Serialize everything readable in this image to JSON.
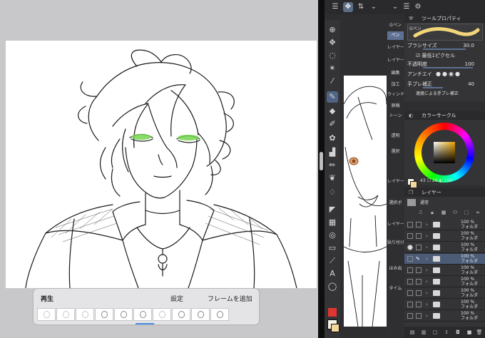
{
  "animation_bar": {
    "play": "再生",
    "settings": "設定",
    "add_frame": "フレームを追加",
    "frame_count": 10,
    "selected_frame": 6
  },
  "clip": {
    "top_icons_left": [
      "menu-icon",
      "layer-move-icon",
      "undo-icon",
      "chevron-icon"
    ],
    "top_icons_right": [
      "chevron-icon",
      "menu-icon",
      "properties-icon"
    ],
    "panels": {
      "tool_property": "ツールプロパティ",
      "color_circle": "カラーサークル",
      "layer": "レイヤー"
    },
    "tool_property": {
      "tab_label": "Gペン",
      "brush_size_label": "ブラシサイズ",
      "brush_size_value": "30.0",
      "min_pixel_label": "最低1ピクセル",
      "opacity_label": "不透明度",
      "opacity_value": "100",
      "antialias_label": "アンチエイ",
      "stabilization_label": "手ブレ補正",
      "stabilization_value": "40",
      "speed_label": "速度による手ブレ補正"
    },
    "subtool_items": [
      {
        "label": "Gペン",
        "selected": false
      },
      {
        "label": "ペン",
        "selected": true
      },
      {
        "label": "レイヤー",
        "selected": false
      },
      {
        "label": "レイヤー②",
        "selected": false
      },
      {
        "label": "編集",
        "selected": false
      },
      {
        "label": "加工",
        "selected": false
      },
      {
        "label": "ウィンドウ",
        "selected": false
      },
      {
        "label": "原稿",
        "selected": false
      },
      {
        "label": "トーン",
        "selected": false
      },
      {
        "label": "透明",
        "selected": false
      },
      {
        "label": "選択",
        "selected": false
      },
      {
        "label": "レイヤー",
        "selected": false
      },
      {
        "label": "選択ボ",
        "selected": false
      },
      {
        "label": "レイヤー",
        "selected": false
      },
      {
        "label": "貼り付け",
        "selected": false
      },
      {
        "label": "はみ出",
        "selected": false
      },
      {
        "label": "タイム",
        "selected": false
      }
    ],
    "color_readout": "43 ☐ 26 ◐ 100",
    "layer_blend": "通常",
    "layers": [
      {
        "opacity": "100 %",
        "name": "フォルダ",
        "selected": false
      },
      {
        "opacity": "100 %",
        "name": "フォルダ",
        "selected": false
      },
      {
        "opacity": "100 %",
        "name": "フォルダ",
        "selected": false
      },
      {
        "opacity": "100 %",
        "name": "フォルダ",
        "selected": true
      },
      {
        "opacity": "100 %",
        "name": "フォルダ",
        "selected": false
      },
      {
        "opacity": "100 %",
        "name": "フォルダ",
        "selected": false
      },
      {
        "opacity": "100 %",
        "name": "フォルダ",
        "selected": false
      },
      {
        "opacity": "100 %",
        "name": "フォルダ",
        "selected": false
      },
      {
        "opacity": "100 %",
        "name": "フォルダ",
        "selected": false
      }
    ],
    "colors": {
      "main": "#f6f3e8",
      "sub": "#f5d79a",
      "accent": "#5b6e88",
      "red": "#e1362f"
    }
  }
}
